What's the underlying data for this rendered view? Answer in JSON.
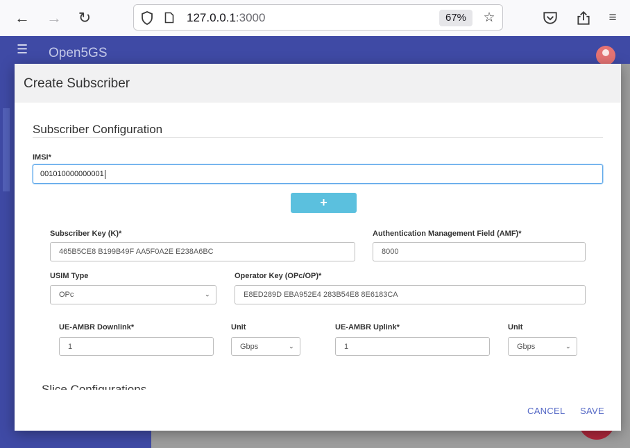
{
  "browser": {
    "url_host": "127.0.0.1",
    "url_port": ":3000",
    "zoom": "67%"
  },
  "app": {
    "title": "Open5GS"
  },
  "modal": {
    "title": "Create Subscriber",
    "section_title": "Subscriber Configuration",
    "imsi": {
      "label": "IMSI*",
      "value": "001010000000001"
    },
    "add_button_label": "+",
    "subscriber_key": {
      "label": "Subscriber Key (K)*",
      "value": "465B5CE8 B199B49F AA5F0A2E E238A6BC"
    },
    "amf": {
      "label": "Authentication Management Field (AMF)*",
      "value": "8000"
    },
    "usim_type": {
      "label": "USIM Type",
      "value": "OPc"
    },
    "operator_key": {
      "label": "Operator Key (OPc/OP)*",
      "value": "E8ED289D EBA952E4 283B54E8 8E6183CA"
    },
    "ambr_downlink": {
      "label": "UE-AMBR Downlink*",
      "value": "1"
    },
    "downlink_unit": {
      "label": "Unit",
      "value": "Gbps"
    },
    "ambr_uplink": {
      "label": "UE-AMBR Uplink*",
      "value": "1"
    },
    "uplink_unit": {
      "label": "Unit",
      "value": "Gbps"
    },
    "slice_title": "Slice Configurations",
    "cancel_label": "CANCEL",
    "save_label": "SAVE"
  }
}
